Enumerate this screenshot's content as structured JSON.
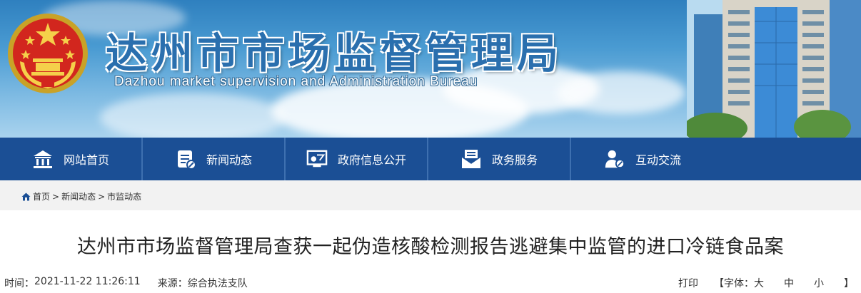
{
  "header": {
    "title": "达州市市场监督管理局",
    "subtitle": "Dazhou market supervision and Administration Bureau"
  },
  "nav": {
    "items": [
      {
        "label": "网站首页",
        "icon": "home-icon"
      },
      {
        "label": "新闻动态",
        "icon": "news-icon"
      },
      {
        "label": "政府信息公开",
        "icon": "info-disclosure-icon"
      },
      {
        "label": "政务服务",
        "icon": "service-mail-icon"
      },
      {
        "label": "互动交流",
        "icon": "user-interaction-icon"
      }
    ]
  },
  "breadcrumb": {
    "items": [
      "首页",
      "新闻动态",
      "市监动态"
    ],
    "separator": ">"
  },
  "article": {
    "title": "达州市市场监督管理局查获一起伪造核酸检测报告逃避集中监管的进口冷链食品案",
    "time_label": "时间：",
    "time": "2021-11-22 11:26:11",
    "source_label": "来源：",
    "source": "综合执法支队"
  },
  "tools": {
    "print": "打印",
    "open_bracket": "【",
    "font_label": "字体：",
    "large": "大",
    "medium": "中",
    "small": "小",
    "close_bracket": "】"
  },
  "colors": {
    "nav_bg": "#1b4f95",
    "title_blue": "#2a6fae",
    "breadcrumb_bg": "#f2f2f2"
  }
}
